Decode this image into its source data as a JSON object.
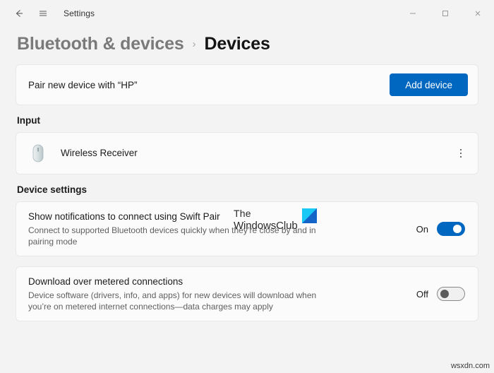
{
  "titlebar": {
    "back_icon": "back-arrow-icon",
    "menu_icon": "hamburger-menu-icon",
    "app_title": "Settings",
    "minimize_label": "—",
    "maximize_label": "□",
    "close_label": "×"
  },
  "header": {
    "parent": "Bluetooth & devices",
    "separator": "›",
    "current": "Devices"
  },
  "pair": {
    "text": "Pair new device with “HP”",
    "button_label": "Add device",
    "button_color": "#0067c0"
  },
  "input_section": {
    "label": "Input",
    "devices": [
      {
        "icon": "mouse-icon",
        "name": "Wireless Receiver",
        "status_color": "#0f7b0f",
        "more_icon": "more-options-icon"
      }
    ]
  },
  "device_settings": {
    "label": "Device settings",
    "rows": [
      {
        "title": "Show notifications to connect using Swift Pair",
        "description": "Connect to supported Bluetooth devices quickly when they’re close by and in pairing mode",
        "toggle_label": "On",
        "toggle_state": "on"
      },
      {
        "title": "Download over metered connections",
        "description": "Device software (drivers, info, and apps) for new devices will download when you’re on metered internet connections—data charges may apply",
        "toggle_label": "Off",
        "toggle_state": "off"
      }
    ]
  },
  "watermarks": {
    "brand_line1": "The",
    "brand_line2": "WindowsClub",
    "brand_logo": "windowsclub-logo-icon",
    "bottom_right": "wsxdn.com"
  }
}
